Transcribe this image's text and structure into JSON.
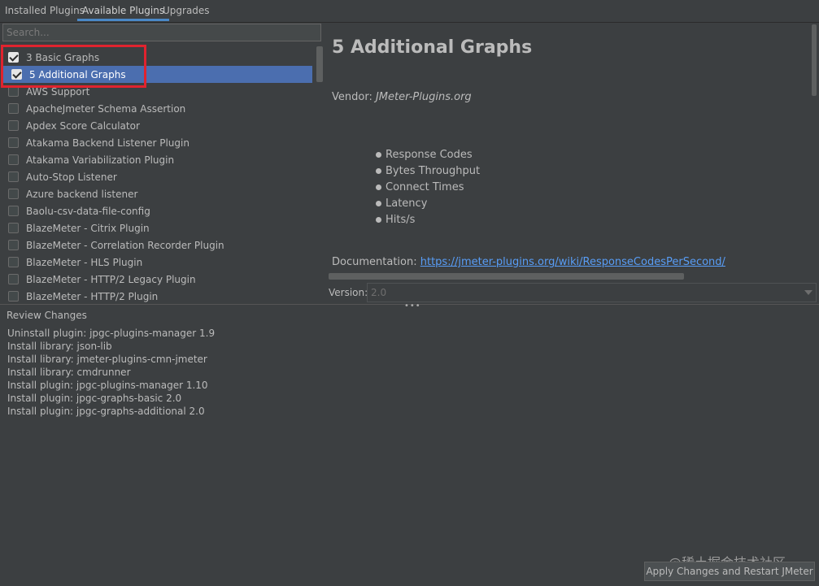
{
  "tabs": [
    {
      "label": "Installed Plugins",
      "active": false
    },
    {
      "label": "Available Plugins",
      "active": true
    },
    {
      "label": "Upgrades",
      "active": false
    }
  ],
  "search": {
    "placeholder": "Search..."
  },
  "plugins": [
    {
      "label": "3 Basic Graphs",
      "checked": true,
      "selected": false
    },
    {
      "label": "5 Additional Graphs",
      "checked": true,
      "selected": true
    },
    {
      "label": "AWS Support",
      "checked": false,
      "selected": false
    },
    {
      "label": "ApacheJmeter Schema Assertion",
      "checked": false,
      "selected": false
    },
    {
      "label": "Apdex Score Calculator",
      "checked": false,
      "selected": false
    },
    {
      "label": "Atakama Backend Listener Plugin",
      "checked": false,
      "selected": false
    },
    {
      "label": "Atakama Variabilization Plugin",
      "checked": false,
      "selected": false
    },
    {
      "label": "Auto-Stop Listener",
      "checked": false,
      "selected": false
    },
    {
      "label": "Azure backend listener",
      "checked": false,
      "selected": false
    },
    {
      "label": "Baolu-csv-data-file-config",
      "checked": false,
      "selected": false
    },
    {
      "label": "BlazeMeter - Citrix Plugin",
      "checked": false,
      "selected": false
    },
    {
      "label": "BlazeMeter - Correlation Recorder Plugin",
      "checked": false,
      "selected": false
    },
    {
      "label": "BlazeMeter - HLS Plugin",
      "checked": false,
      "selected": false
    },
    {
      "label": "BlazeMeter - HTTP/2 Legacy Plugin",
      "checked": false,
      "selected": false
    },
    {
      "label": "BlazeMeter - HTTP/2 Plugin",
      "checked": false,
      "selected": false
    }
  ],
  "detail": {
    "title": "5 Additional Graphs",
    "vendor_label": "Vendor:",
    "vendor_value": "JMeter-Plugins.org",
    "features": [
      "Response Codes",
      "Bytes Throughput",
      "Connect Times",
      "Latency",
      "Hits/s"
    ],
    "doc_label": "Documentation:",
    "doc_link": "https://jmeter-plugins.org/wiki/ResponseCodesPerSecond/",
    "version_label": "Version:",
    "version_value": "2.0"
  },
  "review": {
    "title": "Review Changes",
    "lines": [
      "Uninstall plugin: jpgc-plugins-manager 1.9",
      "Install library: json-lib",
      "Install library: jmeter-plugins-cmn-jmeter",
      "Install library: cmdrunner",
      "Install plugin: jpgc-plugins-manager 1.10",
      "Install plugin: jpgc-graphs-basic 2.0",
      "Install plugin: jpgc-graphs-additional 2.0"
    ]
  },
  "apply_button": "Apply Changes and Restart JMeter",
  "watermark": "@稀土掘金技术社区",
  "colors": {
    "accent": "#4b6eaf",
    "highlight_border": "#e0232e",
    "link": "#589df6",
    "background": "#3c3f41"
  }
}
